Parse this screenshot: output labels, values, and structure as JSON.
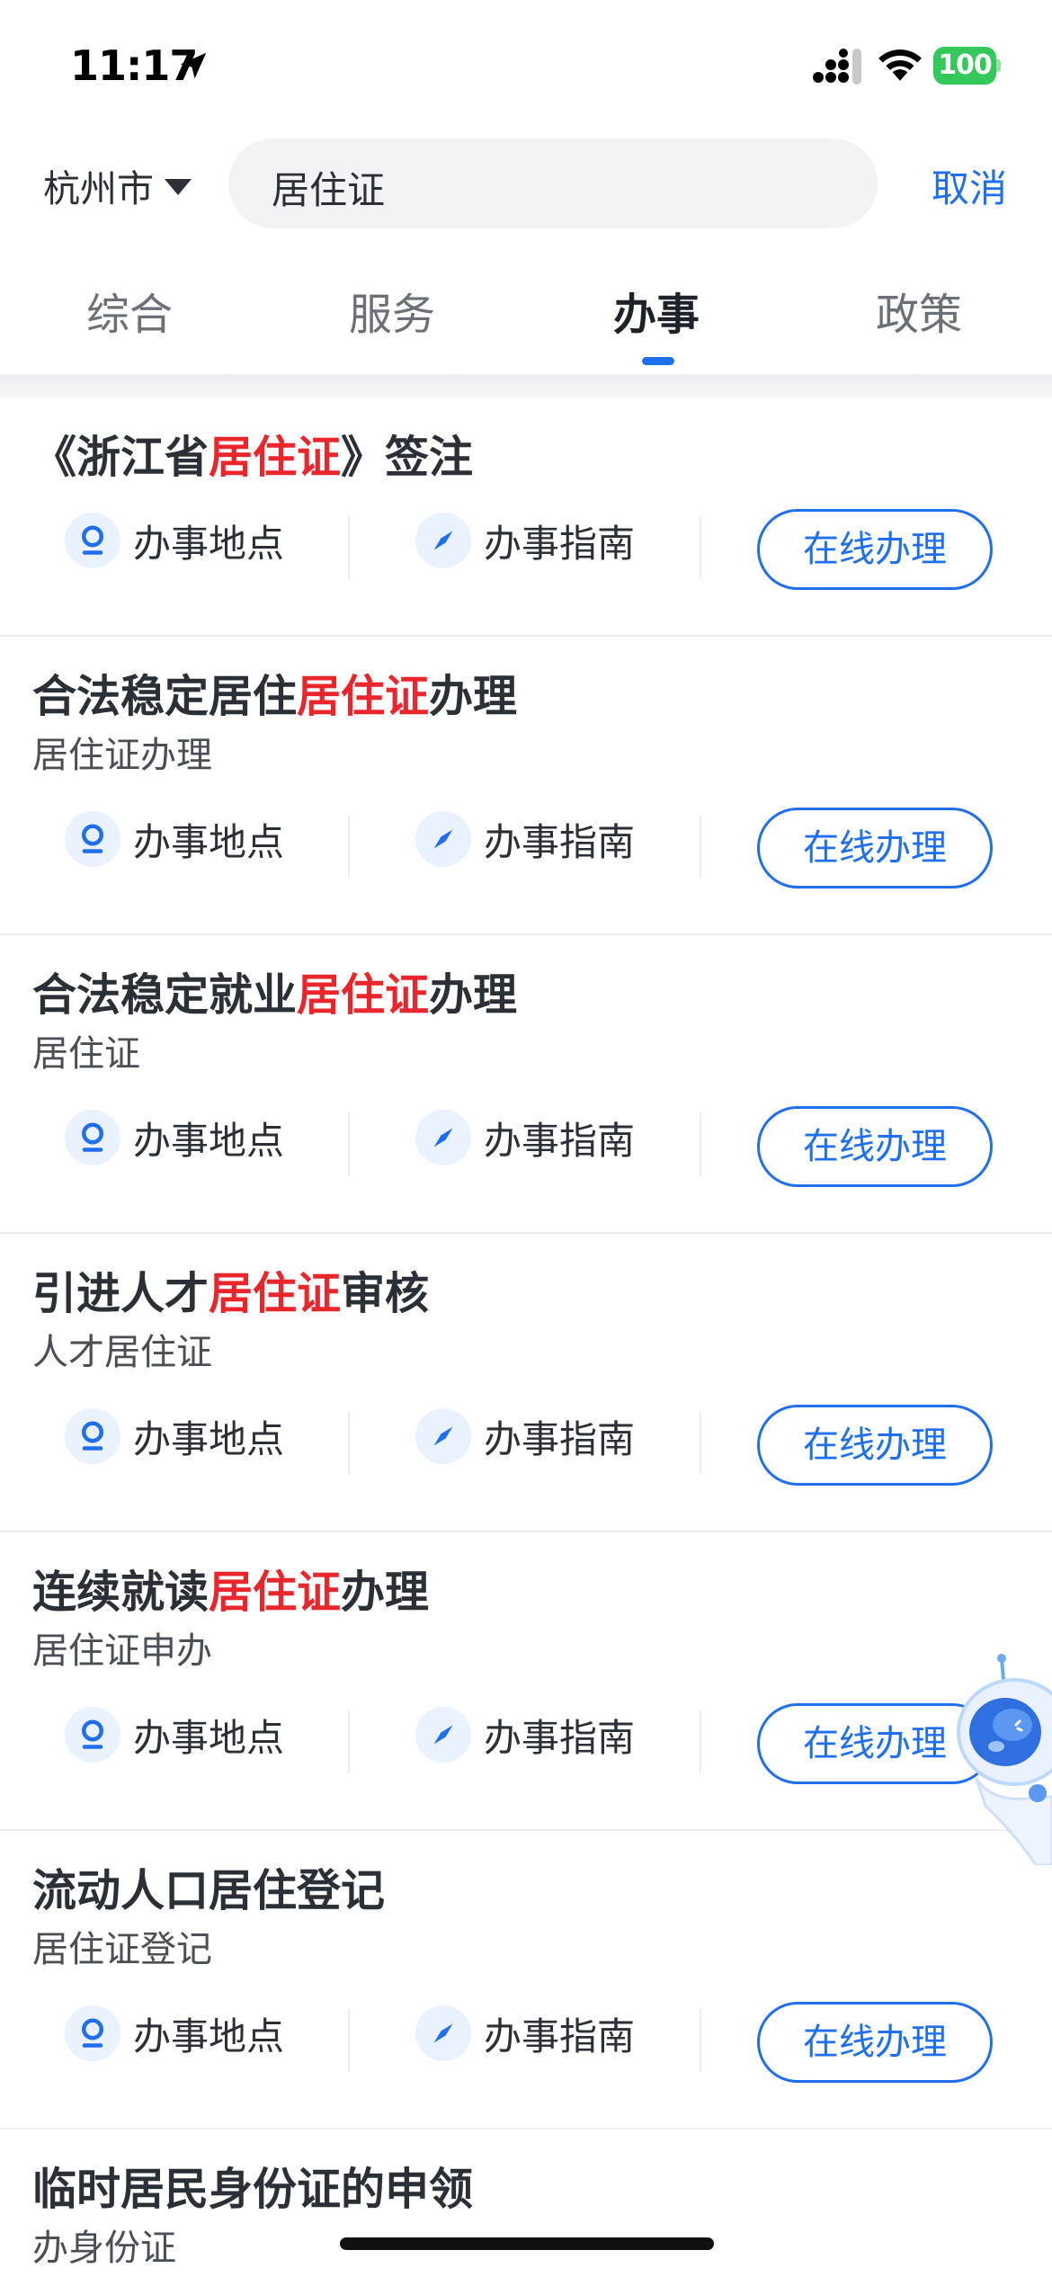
{
  "status_bar": {
    "time": "11:17",
    "battery": "100",
    "icons": [
      "location-arrow-icon",
      "cellular-signal-icon",
      "wifi-icon",
      "battery-icon"
    ]
  },
  "header": {
    "city": "杭州市",
    "search_value": "居住证",
    "cancel_label": "取消"
  },
  "tabs": [
    {
      "label": "综合",
      "active": false
    },
    {
      "label": "服务",
      "active": false
    },
    {
      "label": "办事",
      "active": true
    },
    {
      "label": "政策",
      "active": false
    }
  ],
  "colors": {
    "accent": "#1f6ff0",
    "highlight": "#e8262c",
    "search_bg": "#f2f3f5"
  },
  "actions": {
    "location_label": "办事地点",
    "guide_label": "办事指南",
    "online_label": "在线办理"
  },
  "results": [
    {
      "title_pre": "《浙江省",
      "title_hl": "居住证",
      "title_post": "》签注",
      "subtitle": ""
    },
    {
      "title_pre": "合法稳定居住",
      "title_hl": "居住证",
      "title_post": "办理",
      "subtitle": "居住证办理"
    },
    {
      "title_pre": "合法稳定就业",
      "title_hl": "居住证",
      "title_post": "办理",
      "subtitle": "居住证"
    },
    {
      "title_pre": "引进人才",
      "title_hl": "居住证",
      "title_post": "审核",
      "subtitle": "人才居住证"
    },
    {
      "title_pre": "连续就读",
      "title_hl": "居住证",
      "title_post": "办理",
      "subtitle": "居住证申办"
    },
    {
      "title_pre": "流动人口居住登记",
      "title_hl": "",
      "title_post": "",
      "subtitle": "居住证登记"
    },
    {
      "title_pre": "临时居民身份证的申领",
      "title_hl": "",
      "title_post": "",
      "subtitle": "办身份证"
    }
  ]
}
